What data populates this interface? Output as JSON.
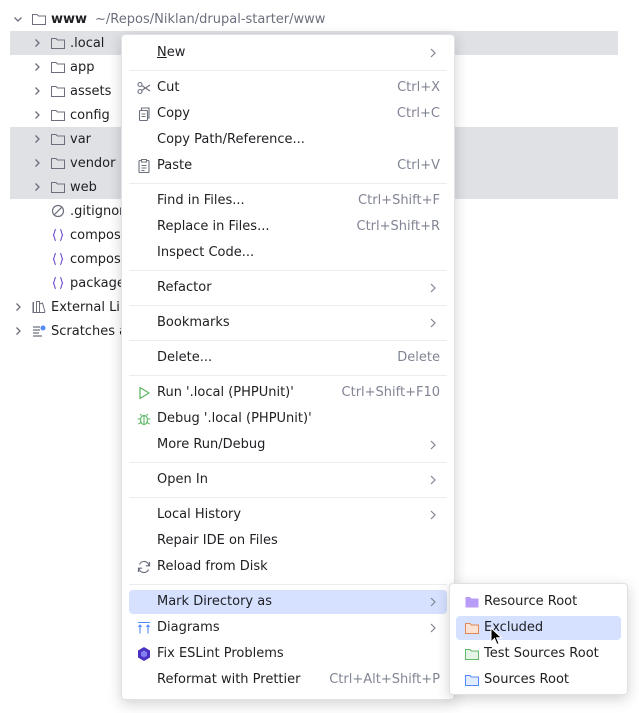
{
  "project_tree": {
    "root": {
      "name": "www",
      "path": "~/Repos/Niklan/drupal-starter/www"
    },
    "folders": [
      ".local",
      "app",
      "assets",
      "config",
      "var",
      "vendor",
      "web"
    ],
    "files": [
      ".gitignor",
      "compose",
      "compose",
      "package"
    ],
    "external_libraries": "External Libr",
    "scratches": "Scratches a"
  },
  "context_menu": {
    "new": "New",
    "cut": {
      "label": "Cut",
      "shortcut": "Ctrl+X"
    },
    "copy": {
      "label": "Copy",
      "shortcut": "Ctrl+C"
    },
    "copy_path": "Copy Path/Reference...",
    "paste": {
      "label": "Paste",
      "shortcut": "Ctrl+V"
    },
    "find_in_files": {
      "label": "Find in Files...",
      "shortcut": "Ctrl+Shift+F"
    },
    "replace_in_files": {
      "label": "Replace in Files...",
      "shortcut": "Ctrl+Shift+R"
    },
    "inspect_code": "Inspect Code...",
    "refactor": "Refactor",
    "bookmarks": "Bookmarks",
    "delete": {
      "label": "Delete...",
      "shortcut": "Delete"
    },
    "run": {
      "label": "Run '.local (PHPUnit)'",
      "shortcut": "Ctrl+Shift+F10"
    },
    "debug": "Debug '.local (PHPUnit)'",
    "more_run_debug": "More Run/Debug",
    "open_in": "Open In",
    "local_history": "Local History",
    "repair_ide": "Repair IDE on Files",
    "reload_from_disk": "Reload from Disk",
    "mark_directory_as": "Mark Directory as",
    "diagrams": "Diagrams",
    "fix_eslint": "Fix ESLint Problems",
    "reformat_prettier": {
      "label": "Reformat with Prettier",
      "shortcut": "Ctrl+Alt+Shift+P"
    }
  },
  "mark_directory_submenu": {
    "resource_root": "Resource Root",
    "excluded": "Excluded",
    "test_sources_root": "Test Sources Root",
    "sources_root": "Sources Root"
  },
  "colors": {
    "selection_row": "#dfe1e5",
    "menu_active": "#d5e1ff",
    "shortcut_text": "#818594",
    "folder_icon": "#6c707e",
    "run_green": "#5fb865",
    "excluded_orange": "#e08855",
    "test_green": "#5fb865",
    "sources_blue": "#548af7",
    "resource_purple": "#b99bf8",
    "eslint_purple": "#4b32c3"
  }
}
